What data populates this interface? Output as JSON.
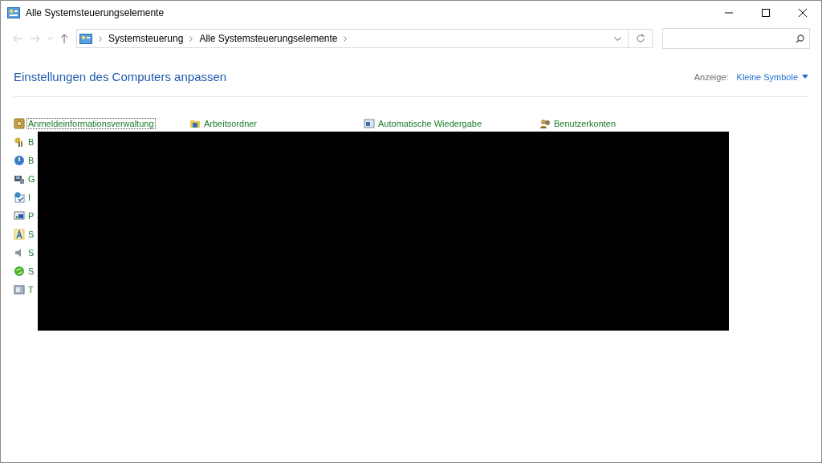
{
  "window": {
    "title": "Alle Systemsteuerungselemente"
  },
  "breadcrumb": [
    "Systemsteuerung",
    "Alle Systemsteuerungselemente"
  ],
  "header": {
    "title": "Einstellungen des Computers anpassen",
    "view_label": "Anzeige:",
    "view_value": "Kleine Symbole"
  },
  "items": [
    {
      "label": "Anmeldeinformationsverwaltung",
      "selected": true
    },
    {
      "label": "Arbeitsordner",
      "selected": false
    },
    {
      "label": "Automatische Wiedergabe",
      "selected": false
    },
    {
      "label": "Benutzerkonten",
      "selected": false
    },
    {
      "label": "B",
      "selected": false
    },
    {
      "label": "B",
      "selected": false
    },
    {
      "label": "G",
      "selected": false
    },
    {
      "label": "I",
      "selected": false
    },
    {
      "label": "P",
      "selected": false
    },
    {
      "label": "S",
      "selected": false
    },
    {
      "label": "S",
      "selected": false
    },
    {
      "label": "S",
      "selected": false
    },
    {
      "label": "T",
      "selected": false
    }
  ]
}
